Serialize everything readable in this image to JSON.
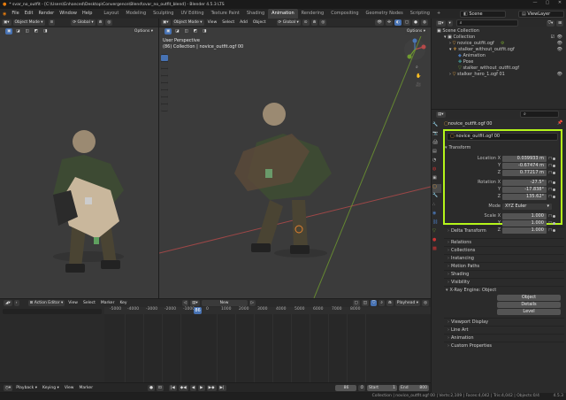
{
  "window": {
    "title": "* svar_no_outfit - [C:\\Users\\Enhanced\\Desktop\\Convergence\\Blend\\svar_no_outfit_blend] - Blender 4.5.3 LTS",
    "minimize": "—",
    "maximize": "▢",
    "close": "✕"
  },
  "menu": [
    "File",
    "Edit",
    "Render",
    "Window",
    "Help"
  ],
  "workspaces": [
    "Layout",
    "Modeling",
    "Sculpting",
    "UV Editing",
    "Texture Paint",
    "Shading",
    "Animation",
    "Rendering",
    "Compositing",
    "Geometry Nodes",
    "Scripting"
  ],
  "active_workspace": "Animation",
  "scene": {
    "label": "Scene",
    "view_layer": "ViewLayer"
  },
  "left_viewport": {
    "mode": "Object Mode",
    "options": "Options"
  },
  "main_viewport": {
    "mode": "Object Mode",
    "menus": [
      "View",
      "Select",
      "Add",
      "Object"
    ],
    "transform": "Global",
    "options": "Options",
    "overlay_line1": "User Perspective",
    "overlay_line2": "(86) Collection | novice_outfit.ogf 00"
  },
  "outliner": {
    "header": "Scene Collection",
    "rows": [
      {
        "label": "Collection",
        "indent": 1
      },
      {
        "label": "novice_outfit.ogf",
        "indent": 2
      },
      {
        "label": "stalker_without_outfit.ogf",
        "indent": 2
      },
      {
        "label": "Animation",
        "indent": 3
      },
      {
        "label": "Pose",
        "indent": 3
      },
      {
        "label": "stalker_without_outfit.ogf",
        "indent": 3
      },
      {
        "label": "stalker_hero_1.ogf 01",
        "indent": 2
      }
    ]
  },
  "properties": {
    "object_name": "novice_outfit.ogf 00",
    "object_field": "novice_outfit.ogf 00",
    "transform_title": "Transform",
    "transform": [
      {
        "label": "Location X",
        "value": "0.039933 m"
      },
      {
        "label": "Y",
        "value": "-0.67474 m"
      },
      {
        "label": "Z",
        "value": "0.77217 m"
      },
      {
        "label": "Rotation X",
        "value": "-27.5°"
      },
      {
        "label": "Y",
        "value": "-17.838°"
      },
      {
        "label": "Z",
        "value": "135.62°"
      },
      {
        "label": "Mode",
        "value": "XYZ Euler"
      },
      {
        "label": "Scale X",
        "value": "1.000"
      },
      {
        "label": "Y",
        "value": "1.000"
      },
      {
        "label": "Z",
        "value": "1.000"
      }
    ],
    "sections_before": [
      "Delta Transform"
    ],
    "sections_mid": [
      "Relations",
      "Collections",
      "Instancing",
      "Motion Paths",
      "Shading",
      "Visibility"
    ],
    "xray_title": "X-Ray Engine: Object",
    "xray_buttons": [
      "Object",
      "Details",
      "Level"
    ],
    "sections_after": [
      "Viewport Display",
      "Line Art",
      "Animation",
      "Custom Properties"
    ]
  },
  "action_editor": {
    "mode": "Action Editor",
    "menus": [
      "View",
      "Select",
      "Marker",
      "Key"
    ],
    "new": "New",
    "playhead": "Playhead",
    "frame_marker": "86",
    "ticks": [
      "-5000",
      "-4000",
      "-3000",
      "-2000",
      "-1000",
      "0",
      "1000",
      "2000",
      "3000",
      "4000",
      "5000",
      "6000",
      "7000",
      "8000"
    ]
  },
  "timeline": {
    "menus": [
      "Playback",
      "Keying",
      "View",
      "Marker"
    ],
    "current_frame": "86",
    "start_label": "Start",
    "start": "1",
    "end_label": "End",
    "end": "800"
  },
  "status": {
    "text": "Collection | novice_outfit.ogf 00 | Verts:2,109 | Faces:4,042 | Tris:4,042 | Objects:0/4",
    "version": "4.5.3"
  },
  "colors": {
    "accent": "#4772b3",
    "highlight": "#b5f51a",
    "x_axis": "#b64a4a",
    "y_axis": "#6f9a2f"
  }
}
